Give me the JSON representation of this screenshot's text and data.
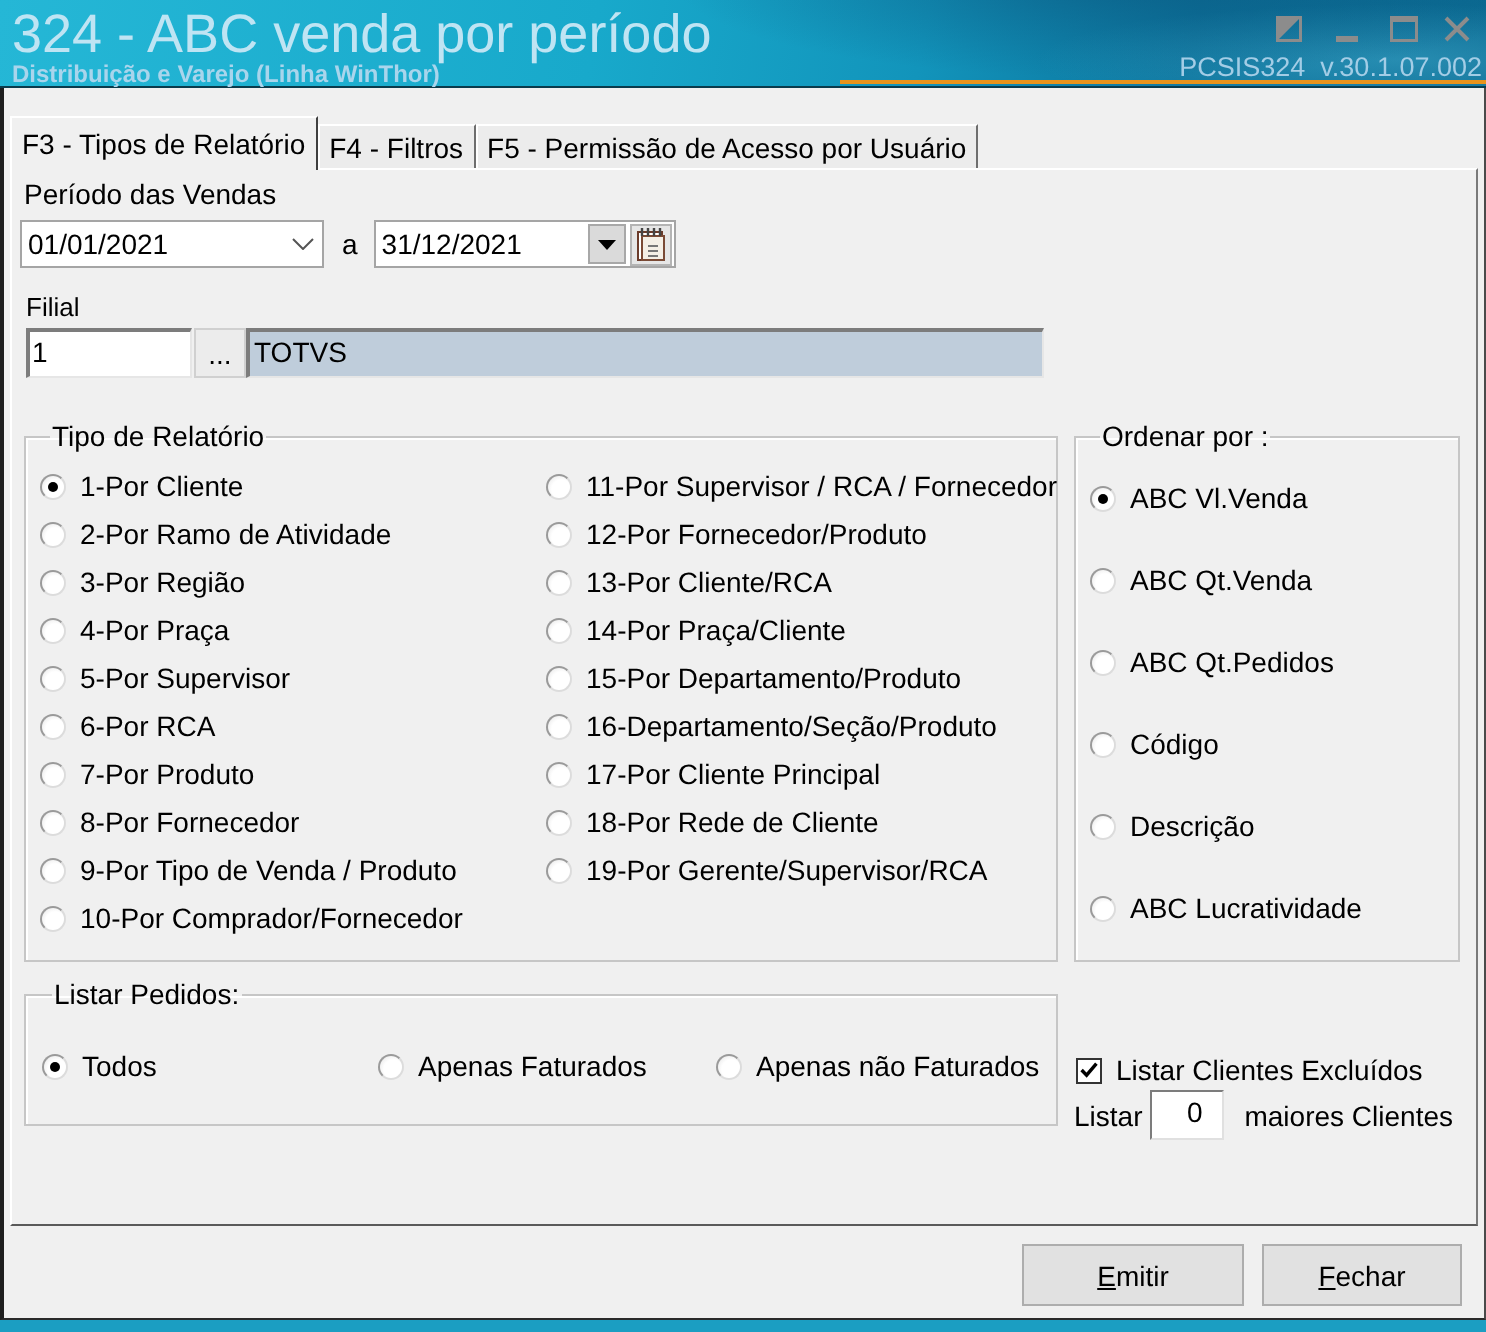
{
  "window": {
    "title": "324 - ABC venda por período",
    "subtitle": "Distribuição e Varejo (Linha WinThor)",
    "version": "PCSIS324  v.30.1.07.002"
  },
  "tabs": [
    {
      "label": "F3 - Tipos de Relatório",
      "selected": true
    },
    {
      "label": "F4 - Filtros",
      "selected": false
    },
    {
      "label": "F5 - Permissão de Acesso por Usuário",
      "selected": false
    }
  ],
  "period": {
    "label": "Período das Vendas",
    "start": "01/01/2021",
    "separator": "a",
    "end": "31/12/2021"
  },
  "branch": {
    "label": "Filial",
    "code": "1",
    "lookup_button": "...",
    "name": "TOTVS"
  },
  "report_type": {
    "title": "Tipo de Relatório",
    "options": [
      {
        "label": "1-Por Cliente",
        "selected": true
      },
      {
        "label": "2-Por Ramo de Atividade",
        "selected": false
      },
      {
        "label": "3-Por Região",
        "selected": false
      },
      {
        "label": "4-Por Praça",
        "selected": false
      },
      {
        "label": "5-Por Supervisor",
        "selected": false
      },
      {
        "label": "6-Por RCA",
        "selected": false
      },
      {
        "label": "7-Por Produto",
        "selected": false
      },
      {
        "label": "8-Por Fornecedor",
        "selected": false
      },
      {
        "label": "9-Por Tipo de Venda / Produto",
        "selected": false
      },
      {
        "label": "10-Por Comprador/Fornecedor",
        "selected": false
      },
      {
        "label": "11-Por Supervisor / RCA / Fornecedor",
        "selected": false
      },
      {
        "label": "12-Por Fornecedor/Produto",
        "selected": false
      },
      {
        "label": "13-Por Cliente/RCA",
        "selected": false
      },
      {
        "label": "14-Por Praça/Cliente",
        "selected": false
      },
      {
        "label": "15-Por Departamento/Produto",
        "selected": false
      },
      {
        "label": "16-Departamento/Seção/Produto",
        "selected": false
      },
      {
        "label": "17-Por Cliente Principal",
        "selected": false
      },
      {
        "label": "18-Por Rede de Cliente",
        "selected": false
      },
      {
        "label": "19-Por Gerente/Supervisor/RCA",
        "selected": false
      }
    ]
  },
  "order_by": {
    "title": "Ordenar por :",
    "options": [
      {
        "label": "ABC Vl.Venda",
        "selected": true
      },
      {
        "label": "ABC Qt.Venda",
        "selected": false
      },
      {
        "label": "ABC Qt.Pedidos",
        "selected": false
      },
      {
        "label": "Código",
        "selected": false
      },
      {
        "label": "Descrição",
        "selected": false
      },
      {
        "label": "ABC Lucratividade",
        "selected": false
      }
    ]
  },
  "list_orders": {
    "title": "Listar Pedidos:",
    "options": [
      {
        "label": "Todos",
        "selected": true
      },
      {
        "label": "Apenas Faturados",
        "selected": false
      },
      {
        "label": "Apenas não Faturados",
        "selected": false
      }
    ]
  },
  "excluded_clients": {
    "label": "Listar Clientes Excluídos",
    "checked": true
  },
  "top_clients": {
    "prefix": "Listar",
    "value": "0",
    "suffix": "maiores Clientes"
  },
  "buttons": [
    {
      "label": "Emitir"
    },
    {
      "label": "Fechar"
    }
  ]
}
